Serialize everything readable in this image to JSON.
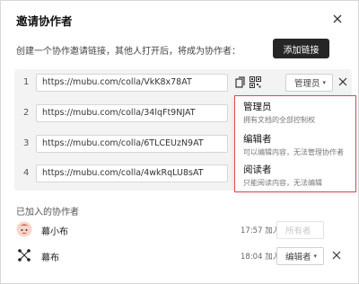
{
  "dialog": {
    "title": "邀请协作者",
    "description": "创建一个协作邀请链接，其他人打开后，将成为协作者：",
    "add_link_label": "添加链接"
  },
  "links": [
    {
      "index": "1",
      "url": "https://mubu.com/colla/VkK8x78AT"
    },
    {
      "index": "2",
      "url": "https://mubu.com/colla/34lqFt9NJAT"
    },
    {
      "index": "3",
      "url": "https://mubu.com/colla/6TLCEUzN9AT"
    },
    {
      "index": "4",
      "url": "https://mubu.com/colla/4wkRqLU8sAT"
    }
  ],
  "row1_role": "管理员",
  "role_menu": [
    {
      "name": "管理员",
      "desc": "拥有文档的全部控制权"
    },
    {
      "name": "编辑者",
      "desc": "可以编辑内容，无法管理协作者"
    },
    {
      "name": "阅读者",
      "desc": "只能阅读内容，无法编辑"
    }
  ],
  "collaborators": {
    "heading": "已加入的协作者",
    "members": [
      {
        "name": "幕小布",
        "time": "17:57 加入",
        "role": "所有者"
      },
      {
        "name": "幕布",
        "time": "18:04 加入",
        "role": "编辑者"
      }
    ]
  },
  "colors": {
    "accent": "#262626",
    "highlight": "#e24a4a",
    "panel": "#f3f3f3"
  }
}
